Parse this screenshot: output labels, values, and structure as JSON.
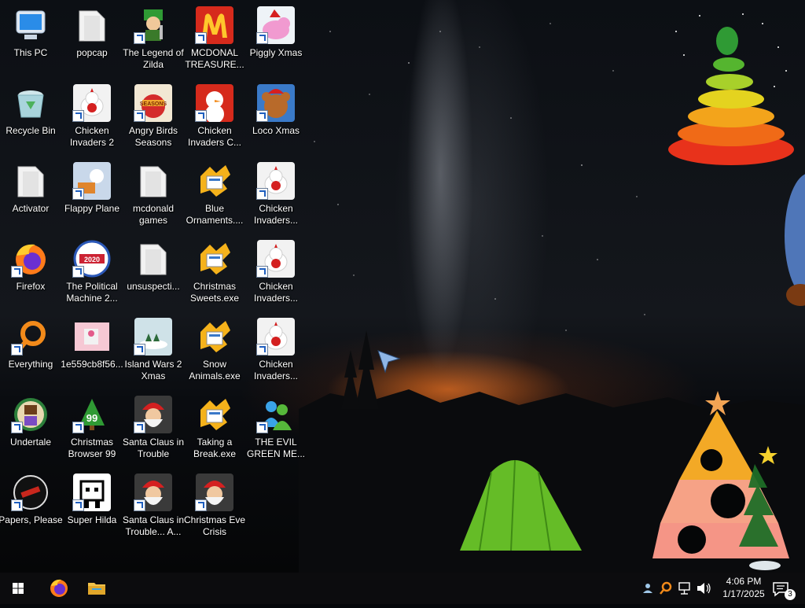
{
  "desktop": {
    "columns": [
      [
        {
          "label": "This PC",
          "icon": "this-pc-icon",
          "shortcut": false
        },
        {
          "label": "Recycle Bin",
          "icon": "recycle-bin-icon",
          "shortcut": false
        },
        {
          "label": "Activator",
          "icon": "folder-icon",
          "shortcut": false
        },
        {
          "label": "Firefox",
          "icon": "firefox-icon",
          "shortcut": true
        },
        {
          "label": "Everything",
          "icon": "everything-search-icon",
          "shortcut": true
        },
        {
          "label": "Undertale",
          "icon": "undertale-icon",
          "shortcut": true
        },
        {
          "label": "Papers, Please",
          "icon": "papers-please-icon",
          "shortcut": true
        }
      ],
      [
        {
          "label": "popcap",
          "icon": "folder-icon",
          "shortcut": false
        },
        {
          "label": "Chicken Invaders 2",
          "icon": "chicken-invaders-icon",
          "shortcut": true
        },
        {
          "label": "Flappy Plane",
          "icon": "game-thumbnail-icon",
          "shortcut": true
        },
        {
          "label": "The Political Machine 2...",
          "icon": "political-machine-icon",
          "shortcut": true
        },
        {
          "label": "1e559cb8f56...",
          "icon": "image-file-icon",
          "shortcut": false
        },
        {
          "label": "Christmas Browser 99",
          "icon": "christmas-tree-icon",
          "shortcut": true
        },
        {
          "label": "Super Hilda",
          "icon": "pixel-game-icon",
          "shortcut": true
        }
      ],
      [
        {
          "label": "The Legend of Zilda",
          "icon": "game-character-icon",
          "shortcut": true
        },
        {
          "label": "Angry Birds Seasons",
          "icon": "angry-birds-icon",
          "shortcut": true
        },
        {
          "label": "mcdonald games",
          "icon": "folder-icon",
          "shortcut": false
        },
        {
          "label": "unsuspecti...",
          "icon": "folder-icon",
          "shortcut": false
        },
        {
          "label": "Island Wars 2 Xmas",
          "icon": "island-wars-icon",
          "shortcut": true
        },
        {
          "label": "Santa Claus in Trouble",
          "icon": "santa-icon",
          "shortcut": true
        },
        {
          "label": "Santa Claus in Trouble... A...",
          "icon": "santa-icon",
          "shortcut": true
        }
      ],
      [
        {
          "label": "MCDONAL TREASURE...",
          "icon": "mcdonalds-icon",
          "shortcut": true
        },
        {
          "label": "Chicken Invaders C...",
          "icon": "snowman-icon",
          "shortcut": true
        },
        {
          "label": "Blue Ornaments....",
          "icon": "setup-exe-icon",
          "shortcut": false
        },
        {
          "label": "Christmas Sweets.exe",
          "icon": "setup-exe-icon",
          "shortcut": false
        },
        {
          "label": "Snow Animals.exe",
          "icon": "setup-exe-icon",
          "shortcut": false
        },
        {
          "label": "Taking a Break.exe",
          "icon": "setup-exe-icon",
          "shortcut": false
        },
        {
          "label": "Christmas Eve Crisis",
          "icon": "santa-icon",
          "shortcut": true
        }
      ],
      [
        {
          "label": "Piggly Xmas",
          "icon": "piggy-icon",
          "shortcut": true
        },
        {
          "label": "Loco Xmas",
          "icon": "teddy-bear-icon",
          "shortcut": true
        },
        {
          "label": "Chicken Invaders...",
          "icon": "chicken-invaders-icon",
          "shortcut": true
        },
        {
          "label": "Chicken Invaders...",
          "icon": "chicken-invaders-icon",
          "shortcut": true
        },
        {
          "label": "Chicken Invaders...",
          "icon": "chicken-invaders-icon",
          "shortcut": true
        },
        {
          "label": "THE EVIL GREEN ME...",
          "icon": "messenger-icon",
          "shortcut": true
        }
      ]
    ]
  },
  "taskbar": {
    "pinned": [
      {
        "name": "start-button",
        "icon": "windows-logo-icon"
      },
      {
        "name": "firefox-taskbar-button",
        "icon": "firefox-icon"
      },
      {
        "name": "file-explorer-taskbar-button",
        "icon": "folder-icon"
      }
    ],
    "tray": {
      "time": "4:06 PM",
      "date": "1/17/2025",
      "notification_count": "3"
    }
  },
  "colors": {
    "taskbar": "#0c0c0e",
    "label_text": "#ffffff"
  }
}
